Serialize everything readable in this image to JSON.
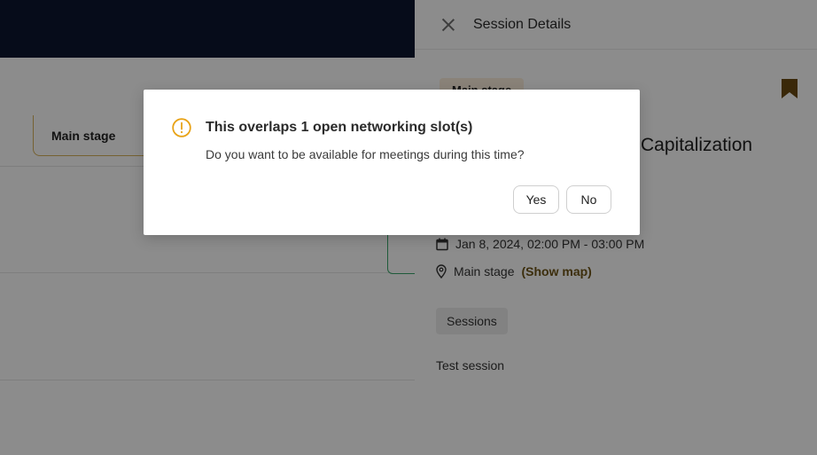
{
  "background": {
    "stage_column_header": "Main stage"
  },
  "panel": {
    "title": "Session Details",
    "stage_chip": "Main stage",
    "session_title": "Capitalization",
    "datetime": "Jan 8, 2024, 02:00 PM - 03:00 PM",
    "location": "Main stage",
    "show_map_label": "(Show map)",
    "tag": "Sessions",
    "description": "Test session"
  },
  "dialog": {
    "title": "This overlaps 1 open networking slot(s)",
    "message": "Do you want to be available for meetings during this time?",
    "yes_label": "Yes",
    "no_label": "No"
  },
  "colors": {
    "topbar": "#0b1730",
    "warning": "#e8a317",
    "bookmark": "#6b4a12",
    "show_map": "#6e5417"
  }
}
